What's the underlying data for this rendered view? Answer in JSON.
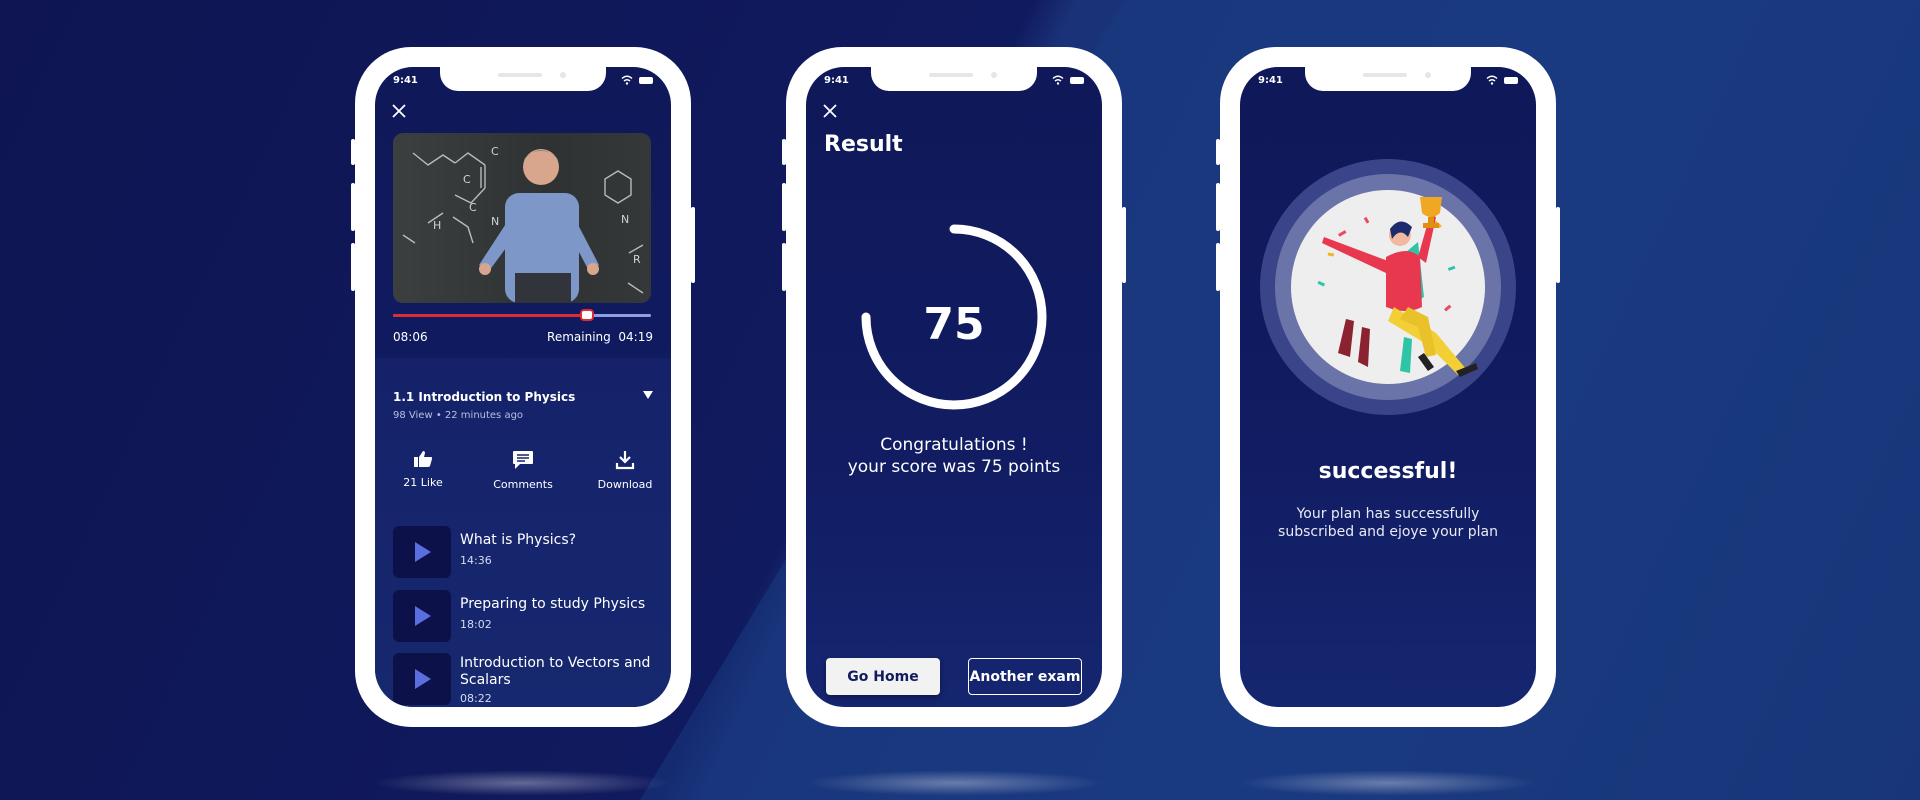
{
  "status": {
    "time": "9:41"
  },
  "player": {
    "progress": 0.75,
    "elapsed": "08:06",
    "remaining_label": "Remaining",
    "remaining": "04:19"
  },
  "lesson": {
    "title": "1.1 Introduction to Physics",
    "meta": "98 View • 22 minutes ago"
  },
  "actions": [
    {
      "label": "21 Like",
      "icon": "thumbs-up-icon"
    },
    {
      "label": "Comments",
      "icon": "comment-icon"
    },
    {
      "label": "Download",
      "icon": "download-icon"
    }
  ],
  "videos": [
    {
      "title": "What is Physics?",
      "duration": "14:36"
    },
    {
      "title": "Preparing to study Physics",
      "duration": "18:02"
    },
    {
      "title": "Introduction to Vectors and Scalars",
      "duration": "08:22"
    }
  ],
  "result": {
    "title": "Result",
    "score": "75",
    "score_fraction": 0.75,
    "congrats_line1": "Congratulations !",
    "congrats_line2": "your score was 75 points",
    "home_button": "Go Home",
    "exam_button": "Another exam"
  },
  "success": {
    "title": "successful!",
    "message": "Your plan has successfully subscribed and ejoye your plan"
  },
  "colors": {
    "background": "#101a5e",
    "accent_red": "#e02a36",
    "play_blue": "#5b6ee0"
  }
}
